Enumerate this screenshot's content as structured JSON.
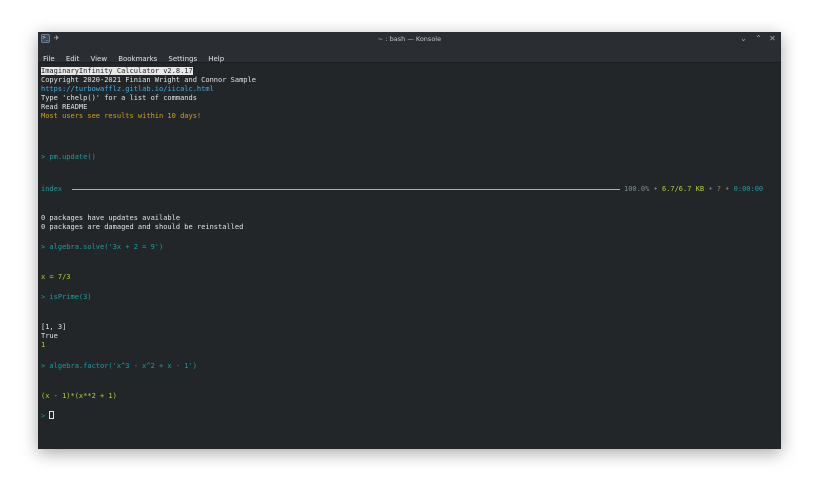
{
  "window": {
    "title": "~ : bash — Konsole",
    "controls": {
      "minimize": "⌄",
      "maximize": "⌃",
      "close": "✕"
    }
  },
  "menu": {
    "items": [
      "File",
      "Edit",
      "View",
      "Bookmarks",
      "Settings",
      "Help"
    ]
  },
  "terminal": {
    "banner": "ImaginaryInfinity Calculator v2.8.17",
    "copyright": "Copyright 2020-2021 Finian Wright and Connor Sample",
    "url": "https://turbowafflz.gitlab.io/iicalc.html",
    "help_hint": "Type 'chelp()' for a list of commands",
    "readme": "Read README",
    "tagline": "Most users see results within 10 days!",
    "cmd1": "> pm.update()",
    "progress": {
      "label": "index",
      "percent": "100.0%",
      "bullet": "•",
      "size": "6.7/6.7 KB",
      "count": "?",
      "time": "0:00:00",
      "fraction": 1.0
    },
    "pkg_line1": "0 packages have updates available",
    "pkg_line2": "0 packages are damaged and should be reinstalled",
    "cmd2": "> algebra.solve('3x + 2 = 9')",
    "out2": "x = 7/3",
    "cmd3": "> isPrime(3)",
    "out3a": "[1, 3]",
    "out3b": "True",
    "out3c": "1",
    "cmd4": "> algebra.factor('x^3 - x^2 + x - 1')",
    "out4": "(x - 1)*(x**2 + 1)",
    "prompt": ">"
  },
  "colors": {
    "terminal_bg": "#232629",
    "link": "#3daee9",
    "warning": "#d4a017",
    "prompt": "#1b9e9e",
    "result": "#b5cf2e",
    "progress": "#a5c93f"
  }
}
